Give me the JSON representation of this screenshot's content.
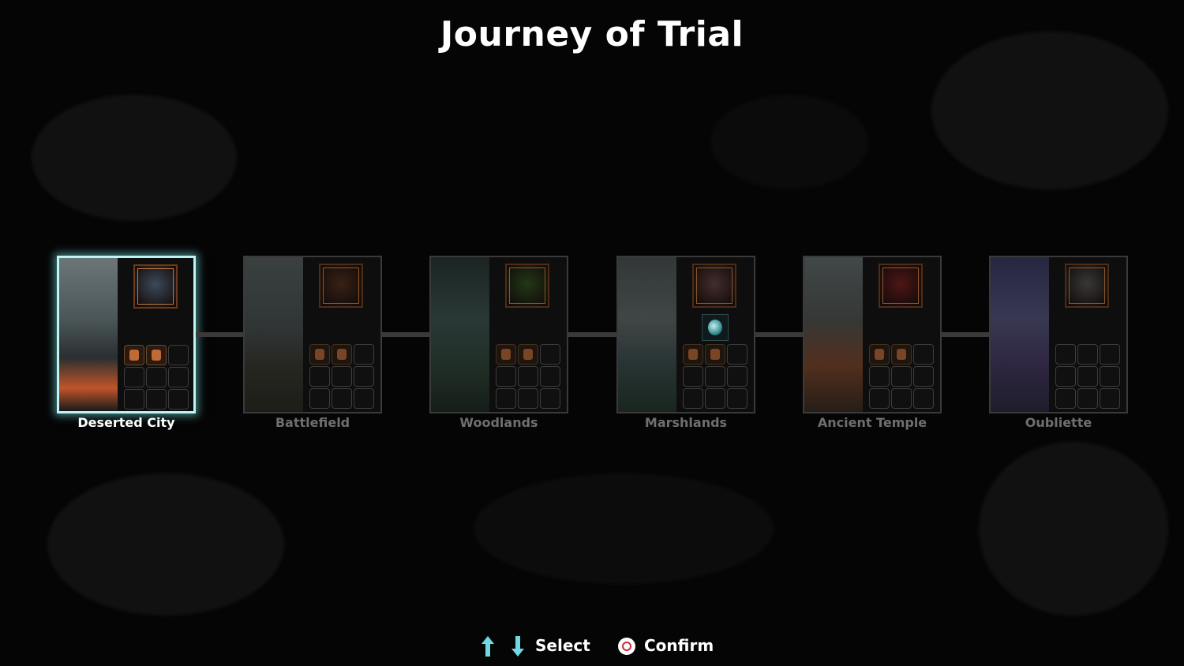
{
  "screen": {
    "title": "Journey of Trial"
  },
  "stages": [
    {
      "name": "Deserted City",
      "selected": true,
      "scene_icon": "burning-city-scene",
      "boss_icon": "undead-general-portrait-icon",
      "filled_slots": 2,
      "has_extra": false
    },
    {
      "name": "Battlefield",
      "selected": false,
      "scene_icon": "battlefield-scene",
      "boss_icon": "white-haired-demon-portrait-icon",
      "filled_slots": 2,
      "has_extra": false
    },
    {
      "name": "Woodlands",
      "selected": false,
      "scene_icon": "bamboo-forest-scene",
      "boss_icon": "forest-beast-portrait-icon",
      "filled_slots": 2,
      "has_extra": false
    },
    {
      "name": "Marshlands",
      "selected": false,
      "scene_icon": "rainy-marsh-scene",
      "boss_icon": "swamp-monster-portrait-icon",
      "filled_slots": 2,
      "has_extra": true,
      "extra_icon": "spirit-orb-icon"
    },
    {
      "name": "Ancient Temple",
      "selected": false,
      "scene_icon": "temple-lantern-scene",
      "boss_icon": "red-oni-portrait-icon",
      "filled_slots": 2,
      "has_extra": false
    },
    {
      "name": "Oubliette",
      "selected": false,
      "scene_icon": "purple-dungeon-scene",
      "boss_icon": "skull-demon-portrait-icon",
      "filled_slots": 0,
      "has_extra": false
    }
  ],
  "footer": {
    "select_label": "Select",
    "confirm_label": "Confirm",
    "up_icon": "arrow-up-icon",
    "down_icon": "arrow-down-icon",
    "confirm_icon": "circle-button-icon",
    "arrow_color": "#6fd8e0"
  }
}
